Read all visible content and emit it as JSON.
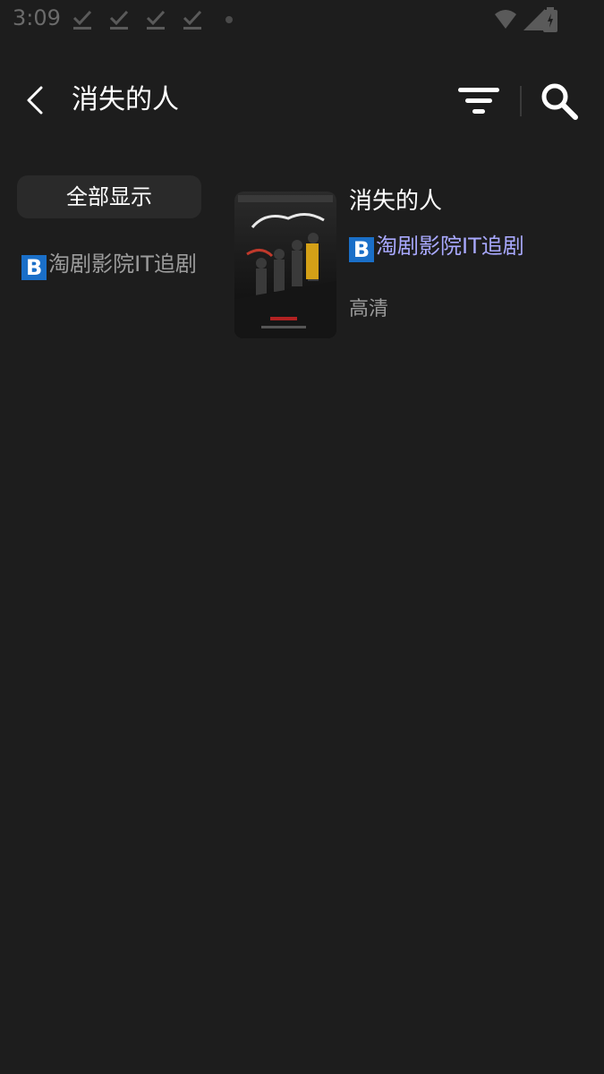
{
  "status_bar": {
    "time": "3:09"
  },
  "header": {
    "title": "消失的人"
  },
  "sidebar": {
    "all_label": "全部显示",
    "source_badge": "B",
    "source_label": "淘剧影院IT追剧"
  },
  "results": [
    {
      "title": "消失的人",
      "source_badge": "B",
      "source": "淘剧影院IT追剧",
      "quality": "高清"
    }
  ],
  "colors": {
    "background": "#1d1d1d",
    "source_link": "#a9a9ff",
    "badge_blue": "#1a6fc8"
  }
}
